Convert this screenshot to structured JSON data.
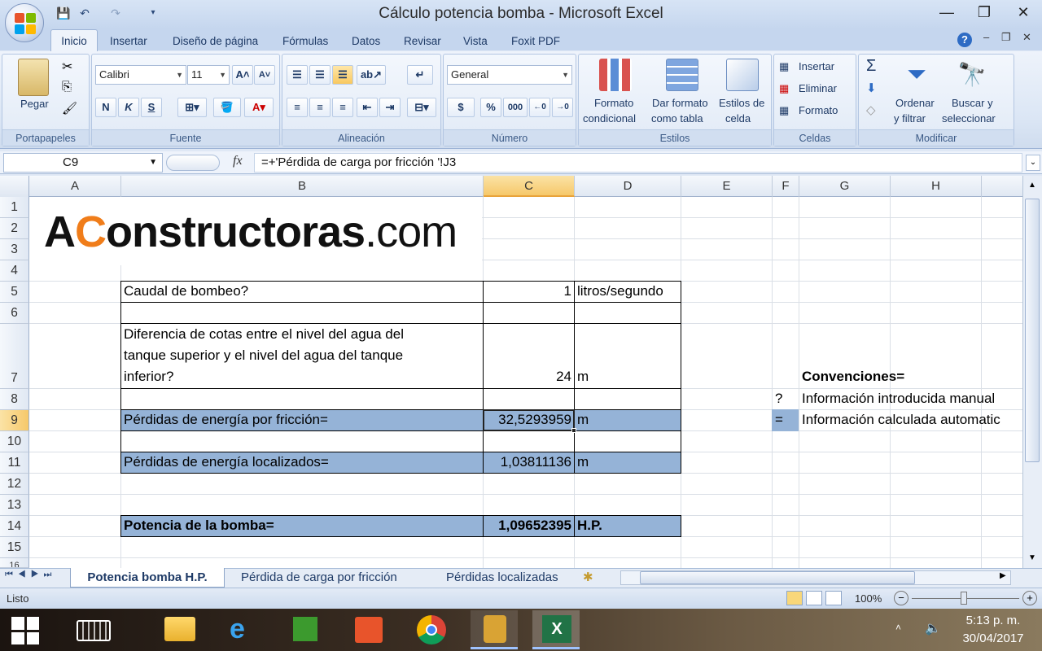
{
  "window": {
    "title": "Cálculo potencia bomba - Microsoft Excel"
  },
  "ribbon": {
    "tabs": [
      "Inicio",
      "Insertar",
      "Diseño de página",
      "Fórmulas",
      "Datos",
      "Revisar",
      "Vista",
      "Foxit PDF"
    ],
    "groups": {
      "portapapeles": "Portapapeles",
      "fuente": "Fuente",
      "alineacion": "Alineación",
      "numero": "Número",
      "estilos": "Estilos",
      "celdas": "Celdas",
      "modificar": "Modificar"
    },
    "pegar": "Pegar",
    "font_name": "Calibri",
    "font_size": "11",
    "number_format": "General",
    "bold": "N",
    "italic": "K",
    "underline": "S",
    "currency": "$",
    "percent": "%",
    "thousands": "000",
    "formato_condicional": [
      "Formato",
      "condicional"
    ],
    "dar_formato": [
      "Dar formato",
      "como tabla"
    ],
    "estilos_celda": [
      "Estilos de",
      "celda"
    ],
    "insertar": "Insertar",
    "eliminar": "Eliminar",
    "formato": "Formato",
    "ordenar": [
      "Ordenar",
      "y filtrar"
    ],
    "buscar": [
      "Buscar y",
      "seleccionar"
    ]
  },
  "formula_bar": {
    "name_box": "C9",
    "fx": "fx",
    "formula": "=+'Pérdida de carga por fricción '!J3"
  },
  "grid": {
    "columns": [
      "A",
      "B",
      "C",
      "D",
      "E",
      "F",
      "G",
      "H"
    ],
    "rows": [
      "1",
      "2",
      "3",
      "4",
      "5",
      "6",
      "7",
      "8",
      "9",
      "10",
      "11",
      "12",
      "13",
      "14",
      "15",
      "16"
    ],
    "logo": {
      "a": "A",
      "c": "C",
      "rest": "onstructoras",
      "dom": ".com"
    },
    "cells": {
      "B5": "Caudal de bombeo?",
      "C5": "1",
      "D5": "litros/segundo",
      "B7a": "Diferencia de cotas entre el nivel del agua del",
      "B7b": "tanque superior y el nivel del agua del tanque",
      "B7c": "inferior?",
      "C7": "24",
      "D7": "m",
      "B9": "Pérdidas de energía por fricción=",
      "C9": "32,5293959",
      "D9": "m",
      "B11": "Pérdidas de energía localizados=",
      "C11": "1,03811136",
      "D11": "m",
      "B14": "Potencia de la bomba=",
      "C14": "1,09652395",
      "D14": "H.P.",
      "G7": "Convenciones=",
      "F8": "?",
      "G8": "Información introducida manual",
      "F9": "=",
      "G9": "Información calculada automatic"
    }
  },
  "sheets": [
    "Potencia bomba H.P.",
    "Pérdida de carga por fricción",
    "Pérdidas localizadas"
  ],
  "status": {
    "text": "Listo",
    "zoom": "100%"
  },
  "taskbar": {
    "time": "5:13 p. m.",
    "date": "30/04/2017"
  },
  "colors": {
    "highlight": "#95b3d7",
    "accent": "#1e3a66"
  }
}
